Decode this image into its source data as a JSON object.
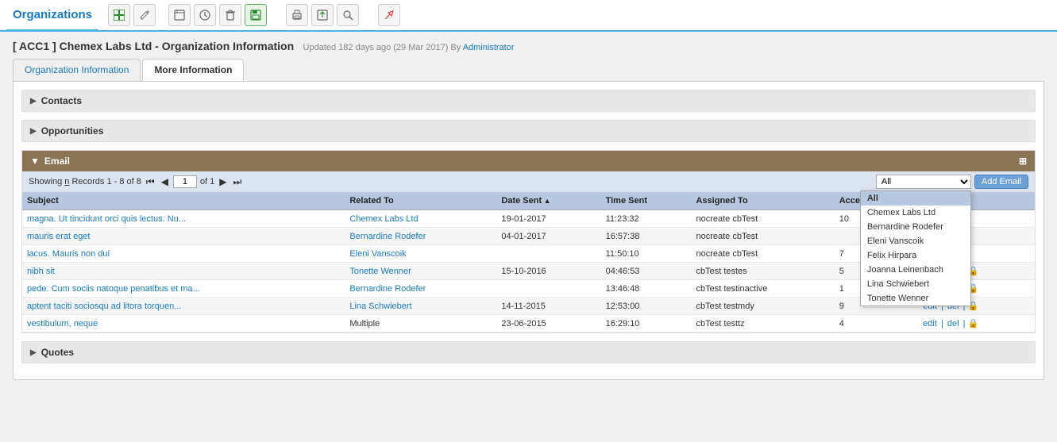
{
  "app": {
    "title": "Organizations"
  },
  "toolbar": {
    "buttons": [
      {
        "name": "add-button",
        "icon": "➕",
        "label": "Add"
      },
      {
        "name": "edit-button",
        "icon": "✏️",
        "label": "Edit"
      },
      {
        "name": "view-button",
        "icon": "🗒",
        "label": "View"
      },
      {
        "name": "history-button",
        "icon": "🕐",
        "label": "History"
      },
      {
        "name": "delete-button",
        "icon": "📋",
        "label": "Delete"
      },
      {
        "name": "save-button",
        "icon": "💾",
        "label": "Save"
      },
      {
        "name": "sep1",
        "icon": "",
        "label": ""
      },
      {
        "name": "print-button",
        "icon": "🖨",
        "label": "Print"
      },
      {
        "name": "export-button",
        "icon": "📤",
        "label": "Export"
      },
      {
        "name": "search-button",
        "icon": "🔍",
        "label": "Search"
      },
      {
        "name": "sep2",
        "icon": "",
        "label": ""
      },
      {
        "name": "tools-button",
        "icon": "🔧",
        "label": "Tools"
      }
    ]
  },
  "record": {
    "title": "[ ACC1 ] Chemex Labs Ltd - Organization Information",
    "meta": "Updated 182 days ago (29 Mar 2017) By",
    "meta_user": "Administrator"
  },
  "tabs": [
    {
      "label": "Organization Information",
      "active": false
    },
    {
      "label": "More Information",
      "active": true
    }
  ],
  "sections": {
    "contacts": {
      "label": "Contacts"
    },
    "opportunities": {
      "label": "Opportunities"
    },
    "email": {
      "label": "Email",
      "pagination": {
        "showing": "Showing",
        "highlight": "n",
        "records": "Records 1 - 8 of 8",
        "page": "1",
        "of_text": "of 1"
      },
      "filter": {
        "selected": "All",
        "options": [
          "All",
          "Chemex Labs Ltd",
          "Bernardine Rodefer",
          "Eleni Vanscoik",
          "Felix Hirpara",
          "Joanna Leinenbach",
          "Lina Schwiebert",
          "Tonette Wenner"
        ]
      },
      "add_button": "Add Email",
      "columns": [
        {
          "key": "subject",
          "label": "Subject"
        },
        {
          "key": "related_to",
          "label": "Related To"
        },
        {
          "key": "date_sent",
          "label": "Date Sent",
          "sorted": true
        },
        {
          "key": "time_sent",
          "label": "Time Sent"
        },
        {
          "key": "assigned_to",
          "label": "Assigned To"
        },
        {
          "key": "access",
          "label": "AccessC"
        },
        {
          "key": "actions",
          "label": "n"
        }
      ],
      "rows": [
        {
          "subject": "magna. Ut tincidunt orci quis lectus. Nu...",
          "related_to": "Chemex Labs Ltd",
          "date_sent": "19-01-2017",
          "time_sent": "11:23:32",
          "assigned_to": "nocreate cbTest",
          "access": "10",
          "actions": "del | 🔒"
        },
        {
          "subject": "mauris erat eget",
          "related_to": "Bernardine Rodefer",
          "date_sent": "04-01-2017",
          "time_sent": "16:57:38",
          "assigned_to": "nocreate cbTest",
          "access": "",
          "actions": "del | 🔒"
        },
        {
          "subject": "lacus. Mauris non dui",
          "related_to": "Eleni Vanscoik",
          "date_sent": "",
          "time_sent": "11:50:10",
          "assigned_to": "nocreate cbTest",
          "access": "7",
          "actions": "del | 🔒"
        },
        {
          "subject": "nibh sit",
          "related_to": "Tonette Wenner",
          "date_sent": "15-10-2016",
          "time_sent": "04:46:53",
          "assigned_to": "cbTest testes",
          "access": "5",
          "actions": "edit | del | 🔒"
        },
        {
          "subject": "pede. Cum sociis natoque penatibus et ma...",
          "related_to": "Bernardine Rodefer",
          "date_sent": "",
          "time_sent": "13:46:48",
          "assigned_to": "cbTest testinactive",
          "access": "1",
          "actions": "edit | del | 🔒"
        },
        {
          "subject": "aptent taciti sociosqu ad litora torquen...",
          "related_to": "Lina Schwiebert",
          "date_sent": "14-11-2015",
          "time_sent": "12:53:00",
          "assigned_to": "cbTest testmdy",
          "access": "9",
          "actions": "edit | del | 🔒"
        },
        {
          "subject": "vestibulum, neque",
          "related_to": "Multiple",
          "date_sent": "23-06-2015",
          "time_sent": "16:29:10",
          "assigned_to": "cbTest testtz",
          "access": "4",
          "actions": "edit | del | 🔒"
        }
      ]
    },
    "quotes": {
      "label": "Quotes"
    }
  }
}
